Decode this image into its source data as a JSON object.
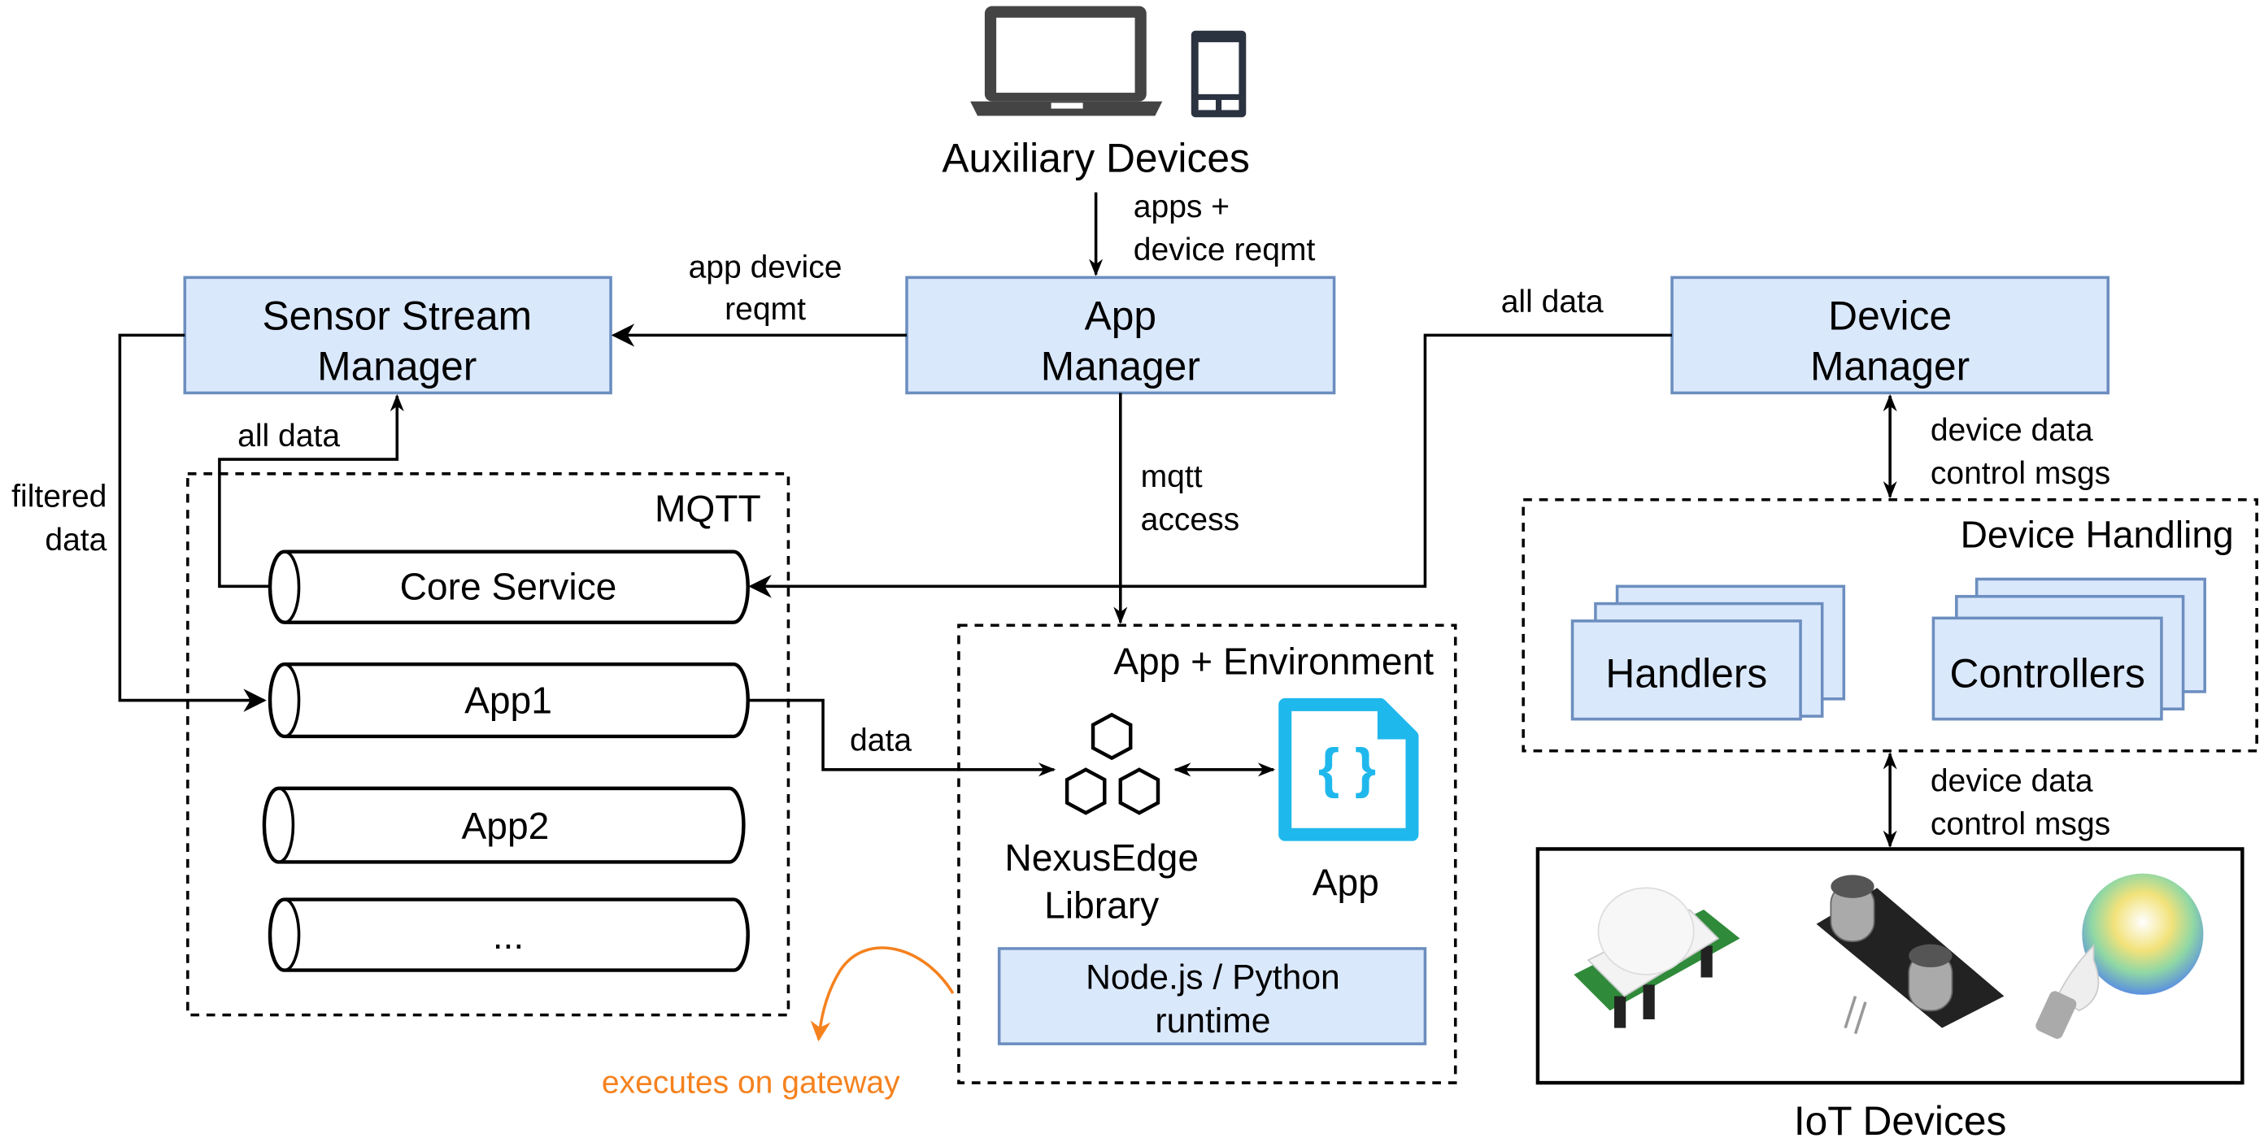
{
  "auxiliary": {
    "label": "Auxiliary Devices",
    "icons": [
      "laptop-icon",
      "phone-icon"
    ],
    "edge_label_1": "apps +",
    "edge_label_2": "device reqmt"
  },
  "sensor_stream_manager": {
    "line1": "Sensor Stream",
    "line2": "Manager"
  },
  "app_manager": {
    "line1": "App",
    "line2": "Manager"
  },
  "device_manager": {
    "line1": "Device",
    "line2": "Manager"
  },
  "edges": {
    "app_device_reqmt_1": "app device",
    "app_device_reqmt_2": "reqmt",
    "all_data_top": "all data",
    "all_data_core": "all data",
    "filtered_1": "filtered",
    "filtered_2": "data",
    "mqtt_access_1": "mqtt",
    "mqtt_access_2": "access",
    "data": "data",
    "dev_data_1": "device data",
    "dev_ctrl_1": "control msgs",
    "dev_data_2": "device data",
    "dev_ctrl_2": "control msgs"
  },
  "mqtt": {
    "title": "MQTT",
    "topics": [
      "Core Service",
      "App1",
      "App2",
      "..."
    ]
  },
  "app_env": {
    "title": "App + Environment",
    "library_1": "NexusEdge",
    "library_2": "Library",
    "app": "App",
    "runtime_1": "Node.js / Python",
    "runtime_2": "runtime"
  },
  "gateway_note": {
    "text": "executes on gateway",
    "color": "#f5821f"
  },
  "device_handling": {
    "title": "Device Handling",
    "handlers": "Handlers",
    "controllers": "Controllers"
  },
  "iot": {
    "label": "IoT Devices",
    "devices": [
      "pir-sensor",
      "ultrasonic-sensor",
      "smart-bulb"
    ]
  },
  "colors": {
    "box_fill": "#dae8fc",
    "box_stroke": "#6c8ebf",
    "app_icon": "#1fb8ec"
  }
}
